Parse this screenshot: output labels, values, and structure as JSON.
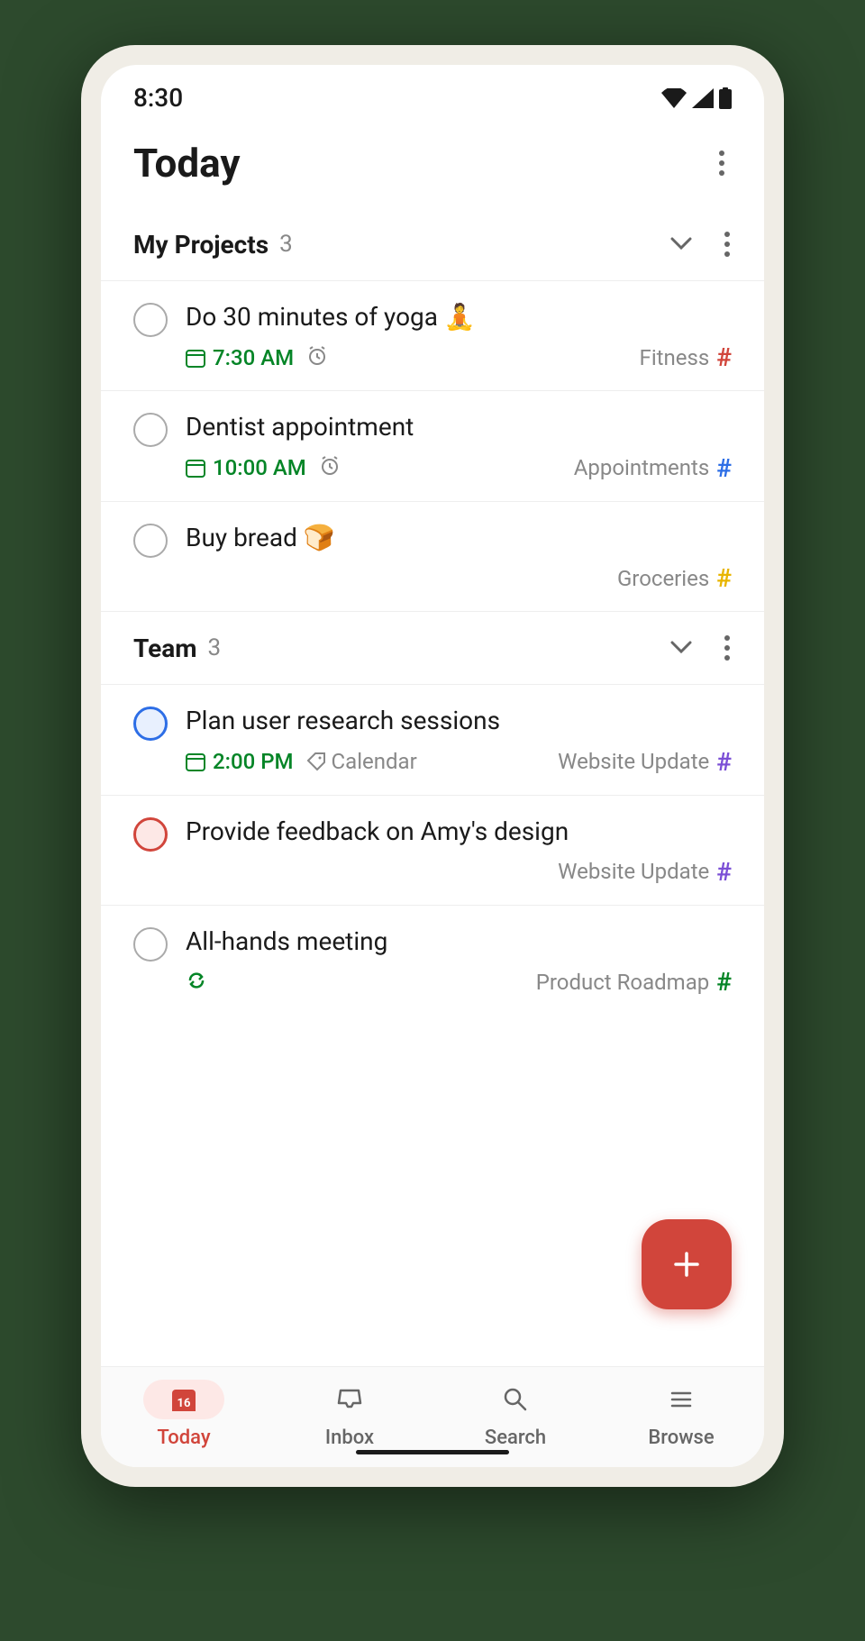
{
  "status": {
    "time": "8:30"
  },
  "header": {
    "title": "Today"
  },
  "sections": [
    {
      "title": "My Projects",
      "count": "3",
      "tasks": [
        {
          "title": "Do 30 minutes of yoga 🧘",
          "due": "7:30 AM",
          "alarm": true,
          "project": "Fitness",
          "hash": "red",
          "checkbox": "gray"
        },
        {
          "title": "Dentist appointment",
          "due": "10:00 AM",
          "alarm": true,
          "project": "Appointments",
          "hash": "blue",
          "checkbox": "gray"
        },
        {
          "title": "Buy bread 🍞",
          "project": "Groceries",
          "hash": "yellow",
          "checkbox": "gray"
        }
      ]
    },
    {
      "title": "Team",
      "count": "3",
      "tasks": [
        {
          "title": "Plan user research sessions",
          "due": "2:00 PM",
          "label": "Calendar",
          "project": "Website Update",
          "hash": "purple",
          "checkbox": "blue"
        },
        {
          "title": "Provide feedback on Amy's design",
          "project": "Website Update",
          "hash": "purple",
          "checkbox": "red"
        },
        {
          "title": "All-hands meeting",
          "recurring": true,
          "project": "Product Roadmap",
          "hash": "green",
          "checkbox": "gray"
        }
      ]
    }
  ],
  "nav": {
    "today": "Today",
    "inbox": "Inbox",
    "search": "Search",
    "browse": "Browse",
    "today_icon_num": "16"
  }
}
